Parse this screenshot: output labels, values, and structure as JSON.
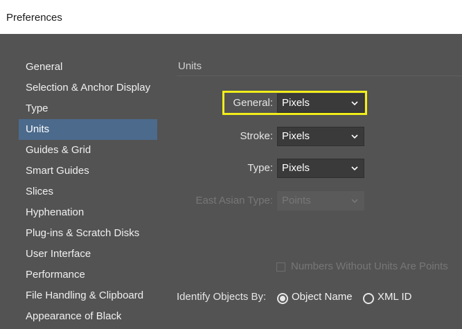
{
  "window": {
    "title": "Preferences"
  },
  "sidebar": {
    "items": [
      {
        "label": "General",
        "active": false
      },
      {
        "label": "Selection & Anchor Display",
        "active": false
      },
      {
        "label": "Type",
        "active": false
      },
      {
        "label": "Units",
        "active": true
      },
      {
        "label": "Guides & Grid",
        "active": false
      },
      {
        "label": "Smart Guides",
        "active": false
      },
      {
        "label": "Slices",
        "active": false
      },
      {
        "label": "Hyphenation",
        "active": false
      },
      {
        "label": "Plug-ins & Scratch Disks",
        "active": false
      },
      {
        "label": "User Interface",
        "active": false
      },
      {
        "label": "Performance",
        "active": false
      },
      {
        "label": "File Handling & Clipboard",
        "active": false
      },
      {
        "label": "Appearance of Black",
        "active": false
      }
    ]
  },
  "units": {
    "section_title": "Units",
    "general": {
      "label": "General:",
      "value": "Pixels"
    },
    "stroke": {
      "label": "Stroke:",
      "value": "Pixels"
    },
    "type": {
      "label": "Type:",
      "value": "Pixels"
    },
    "east_asian_type": {
      "label": "East Asian Type:",
      "value": "Points",
      "disabled": true
    },
    "numbers_without_units": {
      "label": "Numbers Without Units Are Points",
      "checked": false,
      "disabled": true
    },
    "identify_objects": {
      "label": "Identify Objects By:",
      "options": [
        {
          "label": "Object Name",
          "selected": true
        },
        {
          "label": "XML ID",
          "selected": false
        }
      ]
    }
  },
  "colors": {
    "panel_bg": "#535353",
    "selected_item_bg": "#4b6a8c",
    "highlight": "#f2ee1a"
  }
}
